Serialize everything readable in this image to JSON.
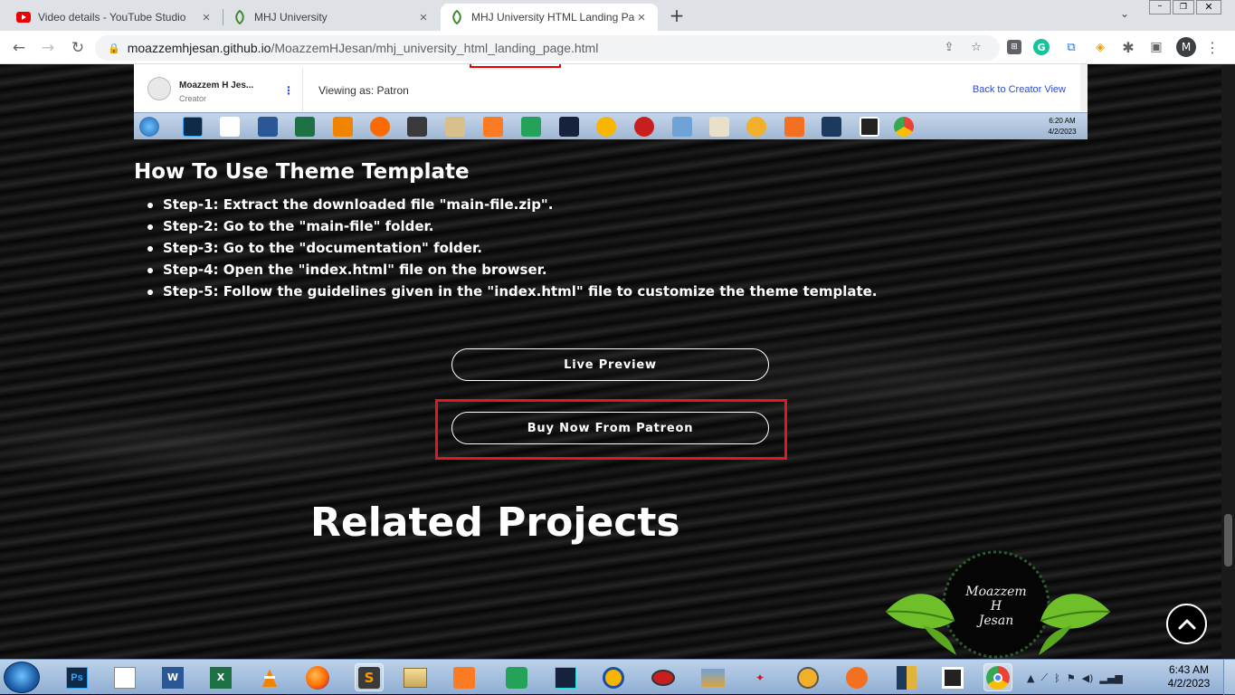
{
  "browser": {
    "tabs": [
      {
        "title": "Video details - YouTube Studio",
        "icon": "youtube-icon"
      },
      {
        "title": "MHJ University",
        "icon": "leaf-logo-icon"
      },
      {
        "title": "MHJ University HTML Landing Pa",
        "icon": "leaf-logo-icon",
        "active": true
      }
    ],
    "new_tab": "+",
    "url_host": "moazzemhjesan.github.io",
    "url_path": "/MoazzemHJesan/mhj_university_html_landing_page.html",
    "profile_initial": "M"
  },
  "embed": {
    "creator_name": "Moazzem H Jes...",
    "creator_role": "Creator",
    "viewing_as": "Viewing as: Patron",
    "back_link": "Back to Creator View",
    "clock_time": "6:20 AM",
    "clock_date": "4/2/2023"
  },
  "content": {
    "howto_title": "How To Use Theme Template",
    "steps": [
      "Step-1: Extract the downloaded file \"main-file.zip\".",
      "Step-2: Go to the \"main-file\" folder.",
      "Step-3: Go to the \"documentation\" folder.",
      "Step-4: Open the \"index.html\" file on the browser.",
      "Step-5: Follow the guidelines given in the \"index.html\" file to customize the theme template."
    ],
    "live_preview": "Live Preview",
    "buy_now": "Buy Now From Patreon",
    "related_title": "Related Projects"
  },
  "logo": {
    "line1": "Moazzem",
    "line2": "H",
    "line3": "Jesan"
  },
  "taskbar": {
    "clock_time": "6:43 AM",
    "clock_date": "4/2/2023"
  },
  "colors": {
    "highlight_red": "#e0191e",
    "leaf_green": "#6fbf2a"
  }
}
